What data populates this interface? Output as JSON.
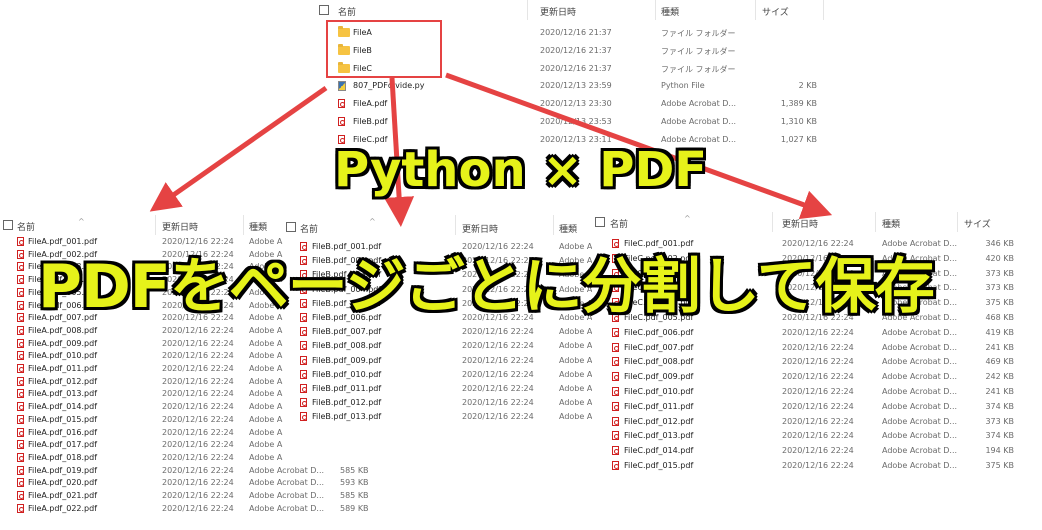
{
  "colors": {
    "accent_red": "#e54343",
    "title_yellow": "#e6f21a",
    "title_outline": "#000000"
  },
  "top_pane": {
    "headers": {
      "name": "名前",
      "date": "更新日時",
      "type": "種類",
      "size": "サイズ"
    },
    "rows": [
      {
        "icon": "folder-icon",
        "name": "FileA",
        "date": "2020/12/16 21:37",
        "type": "ファイル フォルダー",
        "size": ""
      },
      {
        "icon": "folder-icon",
        "name": "FileB",
        "date": "2020/12/16 21:37",
        "type": "ファイル フォルダー",
        "size": ""
      },
      {
        "icon": "folder-icon",
        "name": "FileC",
        "date": "2020/12/16 21:37",
        "type": "ファイル フォルダー",
        "size": ""
      },
      {
        "icon": "python-file-icon",
        "name": "807_PDFdivide.py",
        "date": "2020/12/13 23:59",
        "type": "Python File",
        "size": "2 KB"
      },
      {
        "icon": "pdf-icon",
        "name": "FileA.pdf",
        "date": "2020/12/13 23:30",
        "type": "Adobe Acrobat D...",
        "size": "1,389 KB"
      },
      {
        "icon": "pdf-icon",
        "name": "FileB.pdf",
        "date": "2020/12/13 23:53",
        "type": "Adobe Acrobat D...",
        "size": "1,310 KB"
      },
      {
        "icon": "pdf-icon",
        "name": "FileC.pdf",
        "date": "2020/12/13 23:11",
        "type": "Adobe Acrobat D...",
        "size": "1,027 KB"
      }
    ]
  },
  "pane_a": {
    "headers": {
      "name": "名前",
      "date": "更新日時",
      "type": "種類"
    },
    "rows": [
      {
        "name": "FileA.pdf_001.pdf",
        "date": "2020/12/16 22:24",
        "type": "Adobe A",
        "size": ""
      },
      {
        "name": "FileA.pdf_002.pdf",
        "date": "2020/12/16 22:24",
        "type": "Adobe A",
        "size": ""
      },
      {
        "name": "FileA.pdf_003.pdf",
        "date": "2020/12/16 22:24",
        "type": "Adobe A",
        "size": ""
      },
      {
        "name": "FileA.pdf_004.pdf",
        "date": "2020/12/16 22:24",
        "type": "Adobe A",
        "size": ""
      },
      {
        "name": "FileA.pdf_005.pdf",
        "date": "2020/12/16 22:24",
        "type": "Adobe A",
        "size": ""
      },
      {
        "name": "FileA.pdf_006.pdf",
        "date": "2020/12/16 22:24",
        "type": "Adobe A",
        "size": ""
      },
      {
        "name": "FileA.pdf_007.pdf",
        "date": "2020/12/16 22:24",
        "type": "Adobe A",
        "size": ""
      },
      {
        "name": "FileA.pdf_008.pdf",
        "date": "2020/12/16 22:24",
        "type": "Adobe A",
        "size": ""
      },
      {
        "name": "FileA.pdf_009.pdf",
        "date": "2020/12/16 22:24",
        "type": "Adobe A",
        "size": ""
      },
      {
        "name": "FileA.pdf_010.pdf",
        "date": "2020/12/16 22:24",
        "type": "Adobe A",
        "size": ""
      },
      {
        "name": "FileA.pdf_011.pdf",
        "date": "2020/12/16 22:24",
        "type": "Adobe A",
        "size": ""
      },
      {
        "name": "FileA.pdf_012.pdf",
        "date": "2020/12/16 22:24",
        "type": "Adobe A",
        "size": ""
      },
      {
        "name": "FileA.pdf_013.pdf",
        "date": "2020/12/16 22:24",
        "type": "Adobe A",
        "size": ""
      },
      {
        "name": "FileA.pdf_014.pdf",
        "date": "2020/12/16 22:24",
        "type": "Adobe A",
        "size": ""
      },
      {
        "name": "FileA.pdf_015.pdf",
        "date": "2020/12/16 22:24",
        "type": "Adobe A",
        "size": ""
      },
      {
        "name": "FileA.pdf_016.pdf",
        "date": "2020/12/16 22:24",
        "type": "Adobe A",
        "size": ""
      },
      {
        "name": "FileA.pdf_017.pdf",
        "date": "2020/12/16 22:24",
        "type": "Adobe A",
        "size": ""
      },
      {
        "name": "FileA.pdf_018.pdf",
        "date": "2020/12/16 22:24",
        "type": "Adobe A",
        "size": ""
      },
      {
        "name": "FileA.pdf_019.pdf",
        "date": "2020/12/16 22:24",
        "type": "Adobe Acrobat D...",
        "size": "585 KB"
      },
      {
        "name": "FileA.pdf_020.pdf",
        "date": "2020/12/16 22:24",
        "type": "Adobe Acrobat D...",
        "size": "593 KB"
      },
      {
        "name": "FileA.pdf_021.pdf",
        "date": "2020/12/16 22:24",
        "type": "Adobe Acrobat D...",
        "size": "585 KB"
      },
      {
        "name": "FileA.pdf_022.pdf",
        "date": "2020/12/16 22:24",
        "type": "Adobe Acrobat D...",
        "size": "589 KB"
      }
    ]
  },
  "pane_b": {
    "headers": {
      "name": "名前",
      "date": "更新日時",
      "type": "種類"
    },
    "rows": [
      {
        "name": "FileB.pdf_001.pdf",
        "date": "2020/12/16 22:24",
        "type": "Adobe A"
      },
      {
        "name": "FileB.pdf_002.pdf",
        "date": "2020/12/16 22:24",
        "type": "Adobe A"
      },
      {
        "name": "FileB.pdf_003.pdf",
        "date": "2020/12/16 22:24",
        "type": "Adobe A"
      },
      {
        "name": "FileB.pdf_004.pdf",
        "date": "2020/12/16 22:24",
        "type": "Adobe A"
      },
      {
        "name": "FileB.pdf_005.pdf",
        "date": "2020/12/16 22:24",
        "type": "Adobe A"
      },
      {
        "name": "FileB.pdf_006.pdf",
        "date": "2020/12/16 22:24",
        "type": "Adobe A"
      },
      {
        "name": "FileB.pdf_007.pdf",
        "date": "2020/12/16 22:24",
        "type": "Adobe A"
      },
      {
        "name": "FileB.pdf_008.pdf",
        "date": "2020/12/16 22:24",
        "type": "Adobe A"
      },
      {
        "name": "FileB.pdf_009.pdf",
        "date": "2020/12/16 22:24",
        "type": "Adobe A"
      },
      {
        "name": "FileB.pdf_010.pdf",
        "date": "2020/12/16 22:24",
        "type": "Adobe A"
      },
      {
        "name": "FileB.pdf_011.pdf",
        "date": "2020/12/16 22:24",
        "type": "Adobe A"
      },
      {
        "name": "FileB.pdf_012.pdf",
        "date": "2020/12/16 22:24",
        "type": "Adobe A"
      },
      {
        "name": "FileB.pdf_013.pdf",
        "date": "2020/12/16 22:24",
        "type": "Adobe A"
      }
    ]
  },
  "pane_c": {
    "headers": {
      "name": "名前",
      "date": "更新日時",
      "type": "種類",
      "size": "サイズ"
    },
    "rows": [
      {
        "name": "FileC.pdf_001.pdf",
        "date": "2020/12/16 22:24",
        "type": "Adobe Acrobat D...",
        "size": "346 KB"
      },
      {
        "name": "FileC.pdf_002.pdf",
        "date": "2020/12/16 22:24",
        "type": "Adobe Acrobat D...",
        "size": "420 KB"
      },
      {
        "name": "FileC.pdf_003.pdf",
        "date": "2020/12/16 22:24",
        "type": "Adobe Acrobat D...",
        "size": "373 KB"
      },
      {
        "name": "FileC.pdf_004.pdf",
        "date": "2020/12/16 22:24",
        "type": "Adobe Acrobat D...",
        "size": "373 KB"
      },
      {
        "name": "FileC.pdf_004.pdf",
        "date": "2020/12/16 22:24",
        "type": "Adobe Acrobat D...",
        "size": "375 KB"
      },
      {
        "name": "FileC.pdf_005.pdf",
        "date": "2020/12/16 22:24",
        "type": "Adobe Acrobat D...",
        "size": "468 KB"
      },
      {
        "name": "FileC.pdf_006.pdf",
        "date": "2020/12/16 22:24",
        "type": "Adobe Acrobat D...",
        "size": "419 KB"
      },
      {
        "name": "FileC.pdf_007.pdf",
        "date": "2020/12/16 22:24",
        "type": "Adobe Acrobat D...",
        "size": "241 KB"
      },
      {
        "name": "FileC.pdf_008.pdf",
        "date": "2020/12/16 22:24",
        "type": "Adobe Acrobat D...",
        "size": "469 KB"
      },
      {
        "name": "FileC.pdf_009.pdf",
        "date": "2020/12/16 22:24",
        "type": "Adobe Acrobat D...",
        "size": "242 KB"
      },
      {
        "name": "FileC.pdf_010.pdf",
        "date": "2020/12/16 22:24",
        "type": "Adobe Acrobat D...",
        "size": "241 KB"
      },
      {
        "name": "FileC.pdf_011.pdf",
        "date": "2020/12/16 22:24",
        "type": "Adobe Acrobat D...",
        "size": "374 KB"
      },
      {
        "name": "FileC.pdf_012.pdf",
        "date": "2020/12/16 22:24",
        "type": "Adobe Acrobat D...",
        "size": "373 KB"
      },
      {
        "name": "FileC.pdf_013.pdf",
        "date": "2020/12/16 22:24",
        "type": "Adobe Acrobat D...",
        "size": "374 KB"
      },
      {
        "name": "FileC.pdf_014.pdf",
        "date": "2020/12/16 22:24",
        "type": "Adobe Acrobat D...",
        "size": "194 KB"
      },
      {
        "name": "FileC.pdf_015.pdf",
        "date": "2020/12/16 22:24",
        "type": "Adobe Acrobat D...",
        "size": "375 KB"
      }
    ]
  },
  "overlay": {
    "title_line1": "Python × PDF",
    "title_line2": "PDFをページごとに分割して保存"
  }
}
